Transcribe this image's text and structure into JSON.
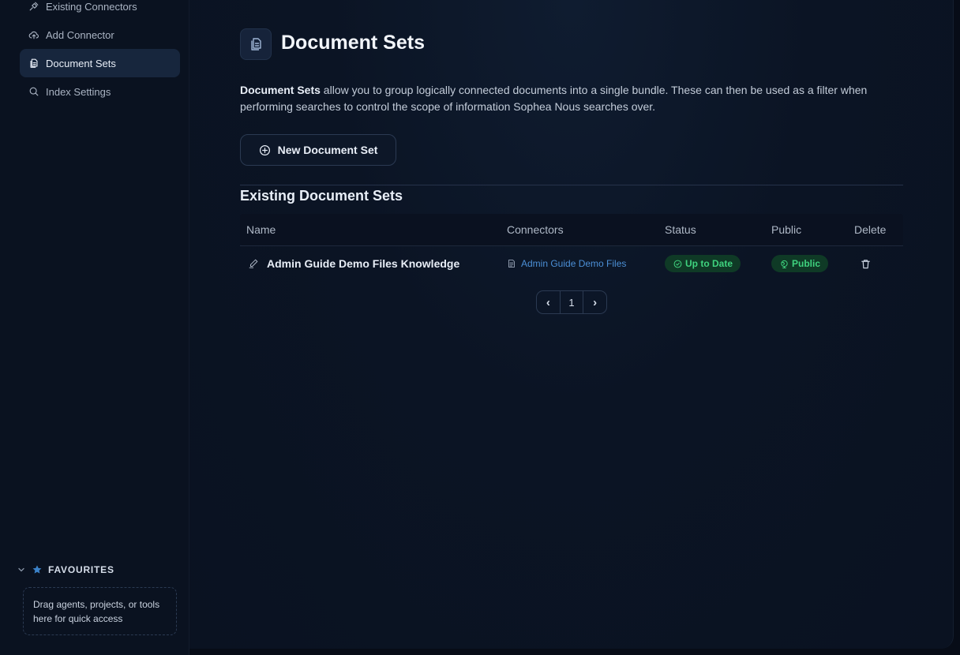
{
  "sidebar": {
    "items": [
      {
        "label": "Existing Connectors",
        "icon": "plug-icon",
        "active": false
      },
      {
        "label": "Add Connector",
        "icon": "cloud-upload-icon",
        "active": false
      },
      {
        "label": "Document Sets",
        "icon": "documents-icon",
        "active": true
      },
      {
        "label": "Index Settings",
        "icon": "search-icon",
        "active": false
      }
    ],
    "favourites": {
      "title": "FAVOURITES",
      "hint": "Drag agents, projects, or tools here for quick access"
    }
  },
  "main": {
    "title": "Document Sets",
    "description_bold": "Document Sets",
    "description_rest": " allow you to group logically connected documents into a single bundle. These can then be used as a filter when performing searches to control the scope of information Sophea Nous searches over.",
    "new_button": "New Document Set",
    "section_title": "Existing Document Sets",
    "table": {
      "headers": [
        "Name",
        "Connectors",
        "Status",
        "Public",
        "Delete"
      ],
      "rows": [
        {
          "name": "Admin Guide Demo Files Knowledge",
          "connector": "Admin Guide Demo Files",
          "status": "Up to Date",
          "public": "Public"
        }
      ]
    },
    "pagination": {
      "prev": "‹",
      "page": "1",
      "next": "›"
    }
  },
  "colors": {
    "accent_link": "#4b8fd6",
    "badge_green": "#3fd27e",
    "active_nav": "#17263d"
  }
}
